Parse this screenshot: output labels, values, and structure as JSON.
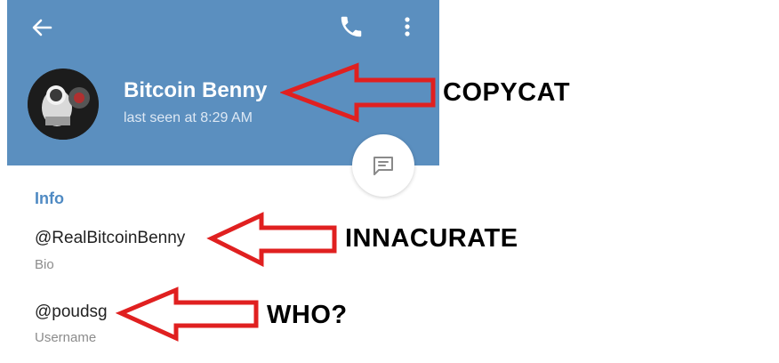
{
  "header": {
    "background_color": "#5b8fbf",
    "back_icon": "arrow-left-icon",
    "call_icon": "phone-icon",
    "menu_icon": "more-vertical-icon"
  },
  "contact": {
    "name": "Bitcoin Benny",
    "status": "last seen at 8:29 AM",
    "avatar_icon": "astronaut-avatar"
  },
  "fab": {
    "icon": "message-icon"
  },
  "info": {
    "heading": "Info",
    "bio_value": "@RealBitcoinBenny",
    "bio_label": "Bio",
    "username_value": "@poudsg",
    "username_label": "Username"
  },
  "annotations": {
    "arrow_color": "#e02020",
    "copycat": "COPYCAT",
    "inaccurate": "INNACURATE",
    "who": "WHO?"
  }
}
